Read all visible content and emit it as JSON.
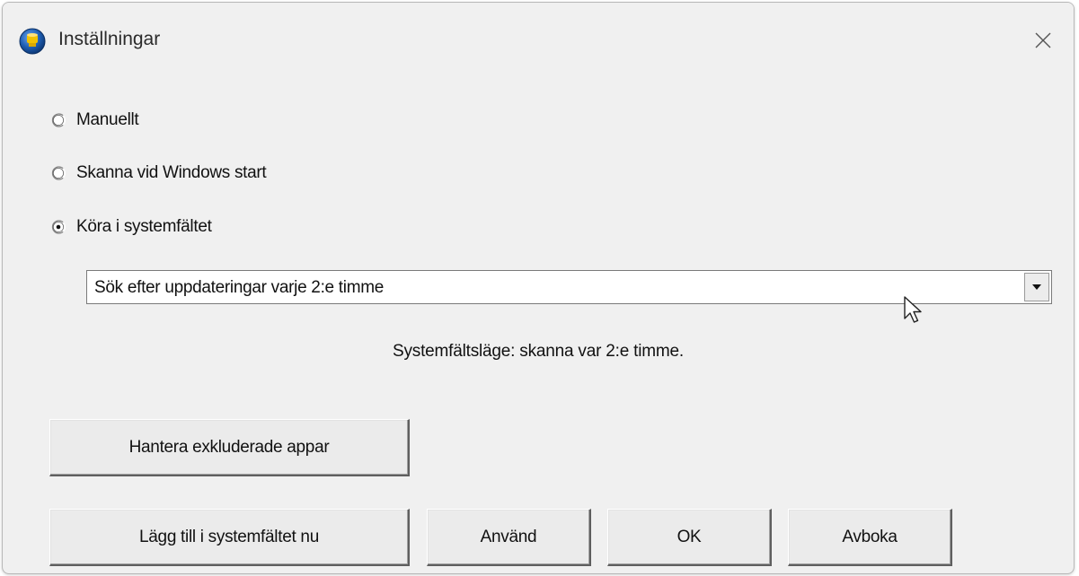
{
  "window": {
    "title": "Inställningar"
  },
  "icons": {
    "app": "app-globe-icon",
    "close": "close-icon",
    "dropdown": "chevron-down-icon",
    "cursor": "mouse-pointer-icon"
  },
  "options": {
    "manual": {
      "label": "Manuellt",
      "checked": false
    },
    "startup": {
      "label": "Skanna vid Windows start",
      "checked": false
    },
    "tray": {
      "label": "Köra i systemfältet",
      "checked": true
    }
  },
  "schedule": {
    "selected": "Sök efter uppdateringar varje 2:e timme"
  },
  "status_text": "Systemfältsläge: skanna var 2:e timme.",
  "buttons": {
    "manage_excluded": "Hantera exkluderade appar",
    "add_to_tray": "Lägg till i systemfältet nu",
    "apply": "Använd",
    "ok": "OK",
    "cancel": "Avboka"
  },
  "colors": {
    "window_bg": "#f0f0f0",
    "app_icon_blue": "#1f5fb4",
    "app_icon_yellow": "#f2c200"
  }
}
